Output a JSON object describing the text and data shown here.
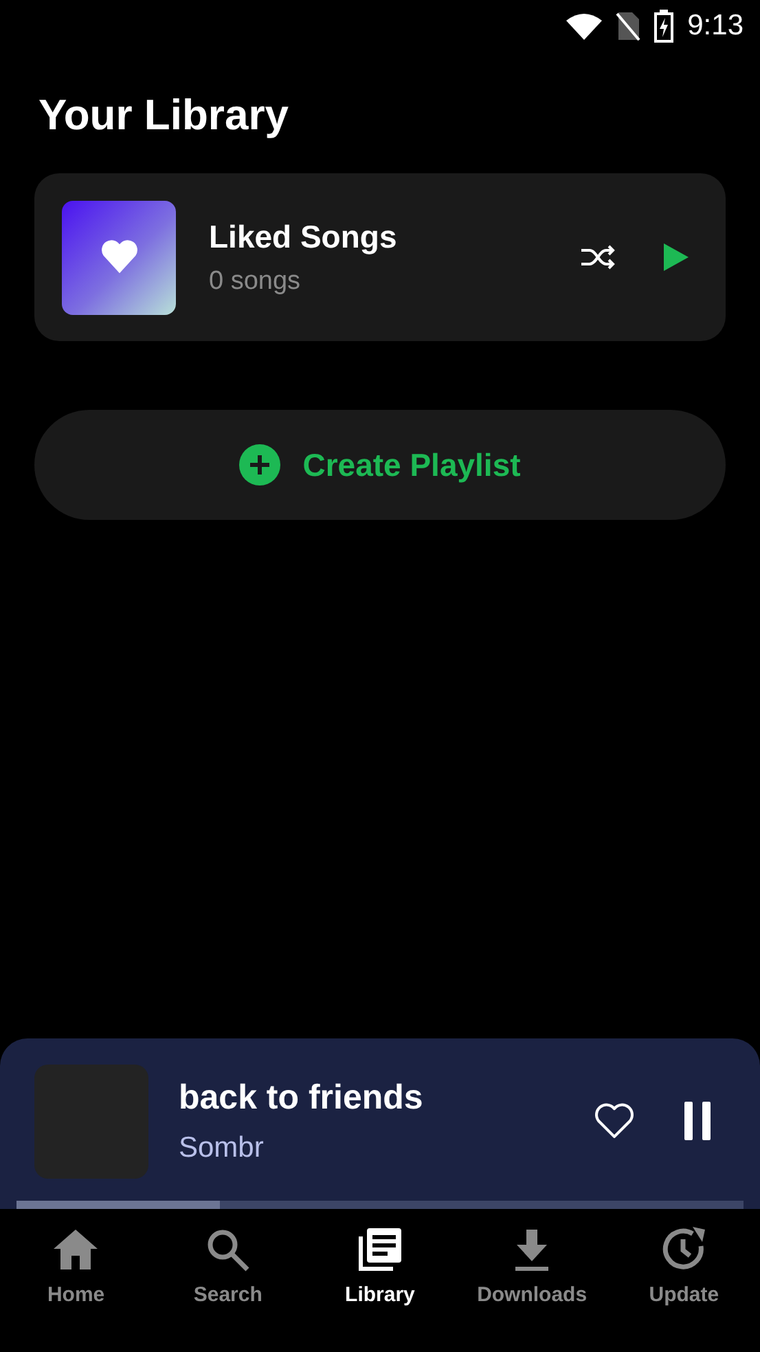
{
  "status_bar": {
    "time": "9:13"
  },
  "title": "Your Library",
  "liked_songs": {
    "title": "Liked Songs",
    "count": "0 songs"
  },
  "create_button": {
    "label": "Create Playlist"
  },
  "player": {
    "title": "back to friends",
    "artist": "Sombr",
    "liked": false,
    "playing": true,
    "level": 0.28
  },
  "nav": [
    {
      "kind": "home",
      "label": "Home",
      "selected": false
    },
    {
      "kind": "search",
      "label": "Search",
      "selected": false
    },
    {
      "kind": "library",
      "label": "Library",
      "selected": true
    },
    {
      "kind": "downloads",
      "label": "Downloads",
      "selected": false
    },
    {
      "kind": "update",
      "label": "Update",
      "selected": false
    }
  ]
}
